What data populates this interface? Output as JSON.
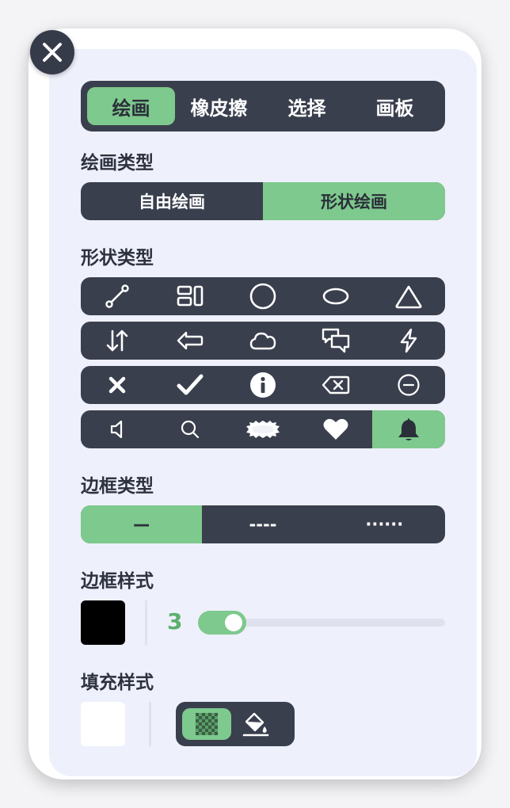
{
  "tabs": [
    {
      "label": "绘画",
      "active": true
    },
    {
      "label": "橡皮擦",
      "active": false
    },
    {
      "label": "选择",
      "active": false
    },
    {
      "label": "画板",
      "active": false
    }
  ],
  "draw_type": {
    "label": "绘画类型",
    "options": [
      {
        "label": "自由绘画",
        "active": false
      },
      {
        "label": "形状绘画",
        "active": true
      }
    ]
  },
  "shape_type": {
    "label": "形状类型",
    "rows": [
      [
        "line-icon",
        "layout-icon",
        "circle-icon",
        "ellipse-icon",
        "triangle-icon"
      ],
      [
        "swap-vertical-icon",
        "arrow-left-icon",
        "cloud-icon",
        "chat-bubbles-icon",
        "lightning-icon"
      ],
      [
        "x-icon",
        "check-icon",
        "info-icon",
        "backspace-icon",
        "minus-circle-icon"
      ],
      [
        "speaker-icon",
        "search-icon",
        "badge-icon",
        "heart-icon",
        "bell-icon"
      ]
    ],
    "selected": "bell-icon"
  },
  "border_type": {
    "label": "边框类型",
    "options": [
      {
        "label": "—",
        "active": true
      },
      {
        "label": "----",
        "active": false
      },
      {
        "label": "······",
        "active": false
      }
    ]
  },
  "border_style": {
    "label": "边框样式",
    "color": "#000000",
    "width": 3,
    "width_min": 1,
    "width_max": 50
  },
  "fill_style": {
    "label": "填充样式",
    "color": "#ffffff",
    "modes": [
      {
        "icon": "checkerboard-icon",
        "active": true
      },
      {
        "icon": "paint-bucket-icon",
        "active": false
      }
    ]
  },
  "colors": {
    "accent": "#7ec98d",
    "dark": "#3a3f4e",
    "panel": "#eef0fb"
  }
}
